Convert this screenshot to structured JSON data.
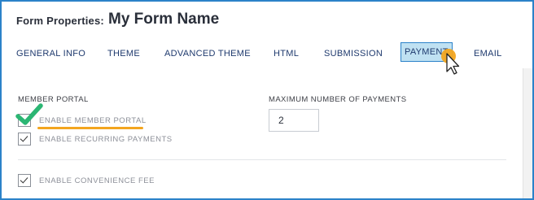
{
  "header": {
    "label": "Form Properties:",
    "form_name": "My Form Name"
  },
  "tabs": [
    {
      "label": "GENERAL INFO",
      "active": false
    },
    {
      "label": "THEME",
      "active": false
    },
    {
      "label": "ADVANCED THEME",
      "active": false
    },
    {
      "label": "HTML",
      "active": false
    },
    {
      "label": "SUBMISSION",
      "active": false
    },
    {
      "label": "PAYMENT",
      "active": true
    },
    {
      "label": "EMAIL",
      "active": false
    }
  ],
  "member_portal": {
    "title": "MEMBER PORTAL",
    "enable_member_portal": {
      "label": "ENABLE MEMBER PORTAL",
      "checked": false
    },
    "enable_recurring_payments": {
      "label": "ENABLE RECURRING PAYMENTS",
      "checked": true
    }
  },
  "max_payments": {
    "title": "MAXIMUM NUMBER OF PAYMENTS",
    "value": "2"
  },
  "convenience_fee": {
    "label": "ENABLE CONVENIENCE FEE",
    "checked": true
  },
  "colors": {
    "frame_border": "#2b82c9",
    "active_tab_bg": "#bfe1f2",
    "annotation_orange": "#f3a51f",
    "annotation_green": "#2bb673",
    "text_dark": "#2a2f3a",
    "tab_text": "#1f3a6e"
  },
  "icons": {
    "annotation_check": "green-checkmark-icon",
    "pointer": "mouse-pointer-icon"
  }
}
